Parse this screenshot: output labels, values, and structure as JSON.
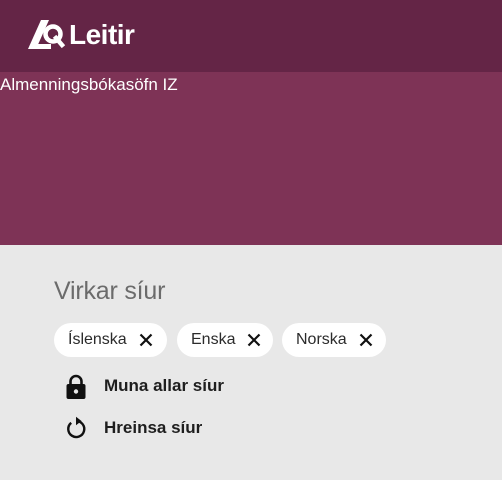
{
  "header": {
    "logo_text": "Leitir",
    "logo_icon": "leitir-logo-icon"
  },
  "banner": {
    "library_name": "Almenningsbókasöfn IZ"
  },
  "active_filters": {
    "heading": "Virkar síur",
    "chips": [
      {
        "label": "Íslenska",
        "remove_icon": "close-icon"
      },
      {
        "label": "Enska",
        "remove_icon": "close-icon"
      },
      {
        "label": "Norska",
        "remove_icon": "close-icon"
      }
    ],
    "actions": {
      "remember": {
        "label": "Muna allar síur",
        "icon": "lock-icon"
      },
      "reset": {
        "label": "Hreinsa síur",
        "icon": "reset-icon"
      }
    }
  },
  "colors": {
    "topbar": "#642546",
    "banner": "#7e3356",
    "filters_bg": "#e8e8e8"
  }
}
